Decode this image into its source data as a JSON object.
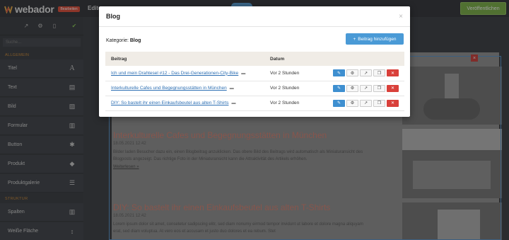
{
  "app": {
    "logo": "webador",
    "beta_badge": "Bearbeiten",
    "edit_tab": "Edito",
    "publish_label": "Veröffentlichen"
  },
  "sidebar": {
    "search_placeholder": "Suche...",
    "category_general": "ALLGEMEIN",
    "category_structure": "STRUKTUR",
    "items": [
      {
        "label": "Titel",
        "icon": "text-icon"
      },
      {
        "label": "Text",
        "icon": "document-icon"
      },
      {
        "label": "Bild",
        "icon": "image-icon"
      },
      {
        "label": "Formular",
        "icon": "form-icon"
      },
      {
        "label": "Button",
        "icon": "button-icon"
      },
      {
        "label": "Produkt",
        "icon": "tag-icon"
      },
      {
        "label": "Produktgalerie",
        "icon": "list-icon"
      }
    ],
    "structure_items": [
      {
        "label": "Spalten",
        "icon": "columns-icon"
      },
      {
        "label": "Weiße Fläche",
        "icon": "spacer-icon"
      }
    ]
  },
  "page": {
    "posts": [
      {
        "title": "Interkulturelle Cafes und Begegnungsstätten in München",
        "date": "18.05.2021 12:42",
        "body": "Bilder laden Besucher dazu ein, einen Blogbeitrag anzuklicken. Das obere Bild des Beitrags wird automatisch als Miniaturansicht des Blogposts angezeigt. Das richtige Foto in der Miniaturansicht kann die Attraktivität des Artikels erhöhen.",
        "more": "Weiterlesen »"
      },
      {
        "title": "DIY: So bastelt ihr einen Einkaufsbeutel aus alten T-Shirts",
        "date": "18.05.2021 12:42",
        "body": "Lorem ipsum dolor sit amet, consetetur sadipscing elitr, sed diam nonumy eirmod tempor invidunt ut labore et dolore magna aliquyam erat, sed diam voluptua. At vero eos et accusam et justo duo dolores et ea rebum. Stet"
      }
    ]
  },
  "modal": {
    "title": "Blog",
    "category_label": "Kategorie:",
    "category_value": "Blog",
    "add_button": "Beitrag hinzufügen",
    "columns": {
      "post": "Beitrag",
      "date": "Datum"
    },
    "rows": [
      {
        "title": "Ich und mein Drahtesel #12 - Das Drei-Generationen-City-Bike",
        "date": "Vor 2 Stunden"
      },
      {
        "title": "Interkulturelle Cafes und Begegnungsstätten in München",
        "date": "Vor 2 Stunden"
      },
      {
        "title": "DIY: So bastelt ihr einen Einkaufsbeutel aus alten T-Shirts",
        "date": "Vor 2 Stunden"
      }
    ]
  }
}
